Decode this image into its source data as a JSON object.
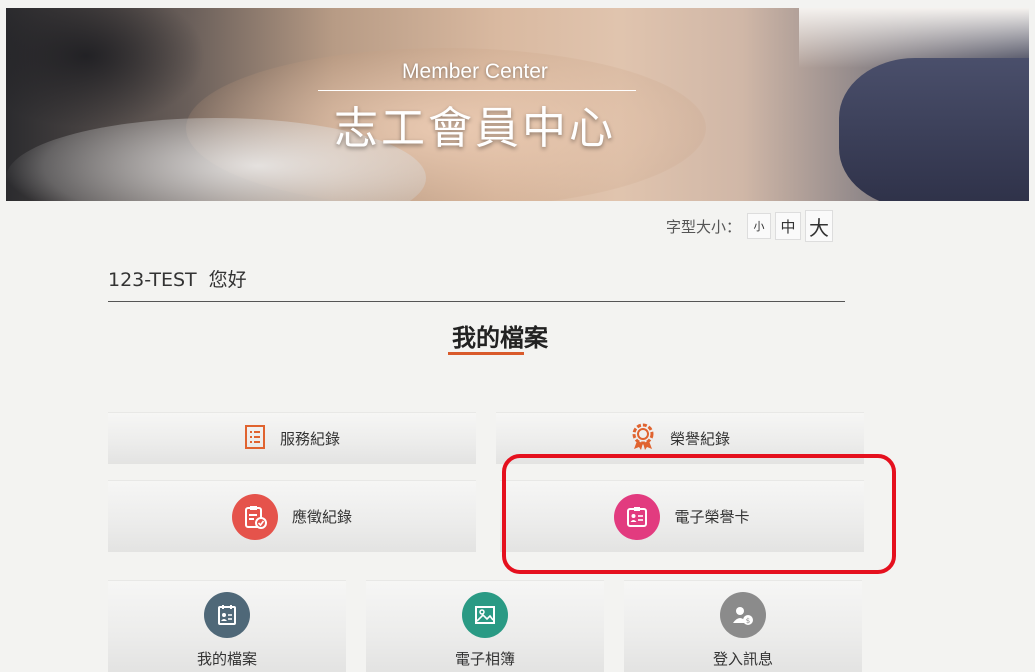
{
  "banner": {
    "title_en": "Member Center",
    "title_zh": "志工會員中心"
  },
  "font_size": {
    "label": "字型大小：",
    "small": "小",
    "medium": "中",
    "large": "大"
  },
  "greeting": {
    "user": "123-TEST",
    "salutation": "您好"
  },
  "section": {
    "title": "我的檔案",
    "accent_color": "#d95a2b"
  },
  "tiles": [
    {
      "label": "服務紀錄",
      "icon": "document-list-icon"
    },
    {
      "label": "榮譽紀錄",
      "icon": "award-badge-icon"
    },
    {
      "label": "應徵紀錄",
      "icon": "clipboard-check-icon"
    },
    {
      "label": "電子榮譽卡",
      "icon": "id-card-icon"
    },
    {
      "label": "我的檔案",
      "icon": "profile-card-icon"
    },
    {
      "label": "電子相簿",
      "icon": "photo-album-icon"
    },
    {
      "label": "登入訊息",
      "icon": "user-info-icon"
    }
  ],
  "highlight_color": "#e5101e"
}
